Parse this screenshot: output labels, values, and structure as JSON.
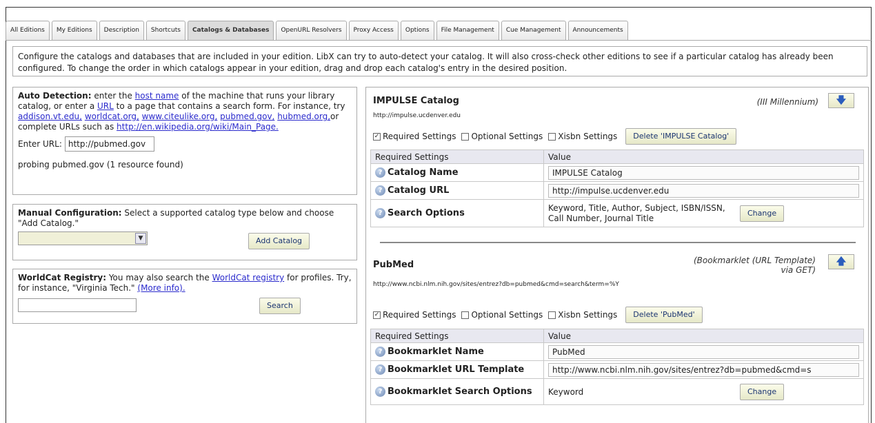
{
  "tabs": [
    {
      "label": "All Editions",
      "active": false
    },
    {
      "label": "My Editions",
      "active": false
    },
    {
      "label": "Description",
      "active": false
    },
    {
      "label": "Shortcuts",
      "active": false
    },
    {
      "label": "Catalogs & Databases",
      "active": true
    },
    {
      "label": "OpenURL Resolvers",
      "active": false
    },
    {
      "label": "Proxy Access",
      "active": false
    },
    {
      "label": "Options",
      "active": false
    },
    {
      "label": "File Management",
      "active": false
    },
    {
      "label": "Cue Management",
      "active": false
    },
    {
      "label": "Announcements",
      "active": false
    }
  ],
  "intro": "Configure the catalogs and databases that are included in your edition. LibX can try to auto-detect your catalog. It will also cross-check other editions to see if a particular catalog has already been configured. To change the order in which catalogs appear in your edition, drag and drop each catalog's entry in the desired position.",
  "auto_detect": {
    "heading": "Auto Detection:",
    "text1": " enter the ",
    "link_host": "host name",
    "text2": " of the machine that runs your library catalog, or enter a ",
    "link_url": "URL",
    "text3": " to a page that contains a search form. For instance, try ",
    "link_addison": "addison.vt.edu,",
    "link_worldcat": "worldcat.org,",
    "link_citeulike": "www.citeulike.org,",
    "link_pubmed": "pubmed.gov,",
    "link_hubmed": "hubmed.org,",
    "text4": "or complete URLs such as ",
    "link_wiki": "http://en.wikipedia.org/wiki/Main_Page.",
    "url_label": "Enter URL:",
    "url_value": "http://pubmed.gov",
    "status": "probing pubmed.gov (1 resource found)"
  },
  "manual": {
    "heading": "Manual Configuration:",
    "text": " Select a supported catalog type below and choose \"Add Catalog.\"",
    "select_value": "",
    "add_button": "Add Catalog"
  },
  "worldcat": {
    "heading": "WorldCat Registry:",
    "text1": " You may also search the ",
    "link_registry": "WorldCat registry",
    "text2": " for profiles. Try, for instance, \"Virginia Tech.\" ",
    "link_more": "(More info).",
    "search_value": "",
    "search_button": "Search"
  },
  "catalogs": [
    {
      "title": "IMPULSE Catalog",
      "url": "http://impulse.ucdenver.edu",
      "type": "(III Millennium)",
      "arrow": "down",
      "checks": [
        {
          "label": "Required Settings",
          "checked": true
        },
        {
          "label": "Optional Settings",
          "checked": false
        },
        {
          "label": "Xisbn Settings",
          "checked": false
        }
      ],
      "delete_label": "Delete 'IMPULSE Catalog'",
      "col_settings": "Required Settings",
      "col_value": "Value",
      "rows": [
        {
          "label": "Catalog Name",
          "value": "IMPULSE Catalog"
        },
        {
          "label": "Catalog URL",
          "value": "http://impulse.ucdenver.edu"
        },
        {
          "label": "Search Options",
          "value": "Keyword, Title, Author, Subject, ISBN/ISSN, Call Number, Journal Title",
          "button": "Change"
        }
      ]
    },
    {
      "title": "PubMed",
      "url": "http://www.ncbi.nlm.nih.gov/sites/entrez?db=pubmed&cmd=search&term=%Y",
      "type": "(Bookmarklet (URL Template) via GET)",
      "arrow": "up",
      "checks": [
        {
          "label": "Required Settings",
          "checked": true
        },
        {
          "label": "Optional Settings",
          "checked": false
        },
        {
          "label": "Xisbn Settings",
          "checked": false
        }
      ],
      "delete_label": "Delete 'PubMed'",
      "col_settings": "Required Settings",
      "col_value": "Value",
      "rows": [
        {
          "label": "Bookmarklet Name",
          "value": "PubMed"
        },
        {
          "label": "Bookmarklet URL Template",
          "value": "http://www.ncbi.nlm.nih.gov/sites/entrez?db=pubmed&cmd=s"
        },
        {
          "label": "Bookmarklet Search Options",
          "value": "Keyword",
          "button": "Change"
        }
      ]
    }
  ],
  "colors": {
    "link": "#2a2acc",
    "arrow": "#2b5dbd",
    "button_text": "#1a3470"
  },
  "icons": {
    "help": "help-icon",
    "down": "arrow-down-icon",
    "up": "arrow-up-icon"
  }
}
